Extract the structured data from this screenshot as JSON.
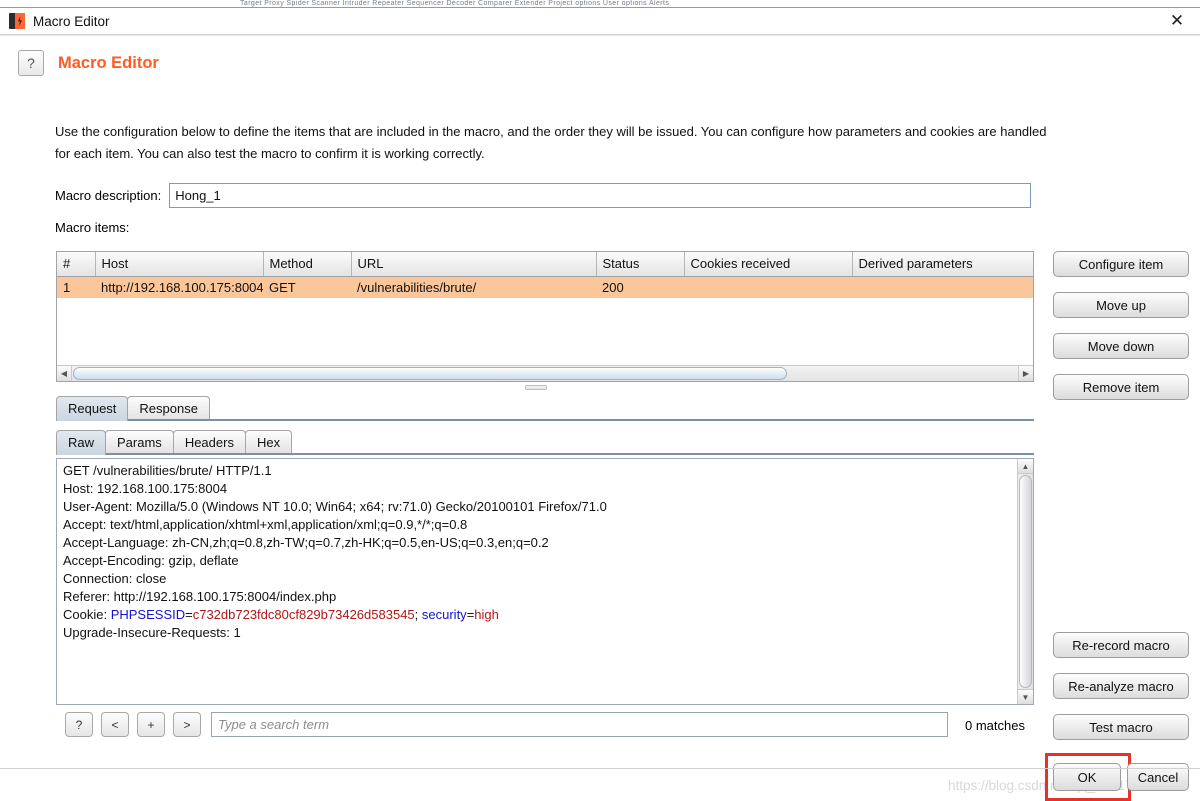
{
  "window": {
    "title": "Macro Editor",
    "app_icon": "burp-icon",
    "close_icon": "close-icon",
    "bg_strip_text": "Target  Proxy  Spider  Scanner  Intruder  Repeater  Sequencer  Decoder  Comparer  Extender  Project options  User options  Alerts"
  },
  "header": {
    "help_icon": "?",
    "title": "Macro Editor",
    "intro": "Use the configuration below to define the items that are included in the macro, and the order they will be issued. You can configure how parameters and cookies are handled for each item. You can also test the macro to confirm it is working correctly."
  },
  "macro_description": {
    "label": "Macro description:",
    "value": "Hong_1",
    "placeholder": ""
  },
  "macro_items": {
    "label": "Macro items:",
    "columns": [
      "#",
      "Host",
      "Method",
      "URL",
      "Status",
      "Cookies received",
      "Derived parameters"
    ],
    "rows": [
      {
        "index": "1",
        "host": "http://192.168.100.175:8004",
        "method": "GET",
        "url": "/vulnerabilities/brute/",
        "status": "200",
        "cookies_received": "",
        "derived_parameters": "",
        "selected": true
      }
    ]
  },
  "side_buttons": [
    {
      "label": "Configure item",
      "name": "configure-item-button"
    },
    {
      "label": "Move up",
      "name": "move-up-button"
    },
    {
      "label": "Move down",
      "name": "move-down-button"
    },
    {
      "label": "Remove item",
      "name": "remove-item-button"
    },
    {
      "label": "Re-record macro",
      "name": "re-record-macro-button"
    },
    {
      "label": "Re-analyze macro",
      "name": "re-analyze-macro-button"
    },
    {
      "label": "Test macro",
      "name": "test-macro-button"
    }
  ],
  "message_tabs": {
    "items": [
      "Request",
      "Response"
    ],
    "active": "Request"
  },
  "view_tabs": {
    "items": [
      "Raw",
      "Params",
      "Headers",
      "Hex"
    ],
    "active": "Raw"
  },
  "request": {
    "lines": [
      "GET /vulnerabilities/brute/ HTTP/1.1",
      "Host: 192.168.100.175:8004",
      "User-Agent: Mozilla/5.0 (Windows NT 10.0; Win64; x64; rv:71.0) Gecko/20100101 Firefox/71.0",
      "Accept: text/html,application/xhtml+xml,application/xml;q=0.9,*/*;q=0.8",
      "Accept-Language: zh-CN,zh;q=0.8,zh-TW;q=0.7,zh-HK;q=0.5,en-US;q=0.3,en;q=0.2",
      "Accept-Encoding: gzip, deflate",
      "Connection: close",
      "Referer: http://192.168.100.175:8004/index.php"
    ],
    "cookie_prefix": "Cookie: ",
    "cookie_key1": "PHPSESSID",
    "cookie_eq": "=",
    "cookie_val1": "c732db723fdc80cf829b73426d583545",
    "cookie_sep": "; ",
    "cookie_key2": "security",
    "cookie_val2": "high",
    "last_line": "Upgrade-Insecure-Requests: 1"
  },
  "search": {
    "help_label": "?",
    "prev_label": "<",
    "add_label": "+",
    "next_label": ">",
    "placeholder": "Type a search term",
    "value": "",
    "matches": "0 matches"
  },
  "dialog_buttons": {
    "ok": "OK",
    "cancel": "Cancel",
    "ok_highlight_color": "#e8312b"
  },
  "watermark": "https://blog.csdn.net/qq_41617034",
  "colors": {
    "accent": "#ff5b24",
    "selected_row": "#fac69a",
    "cookie_key": "#1414cf",
    "cookie_value": "#b01818"
  }
}
